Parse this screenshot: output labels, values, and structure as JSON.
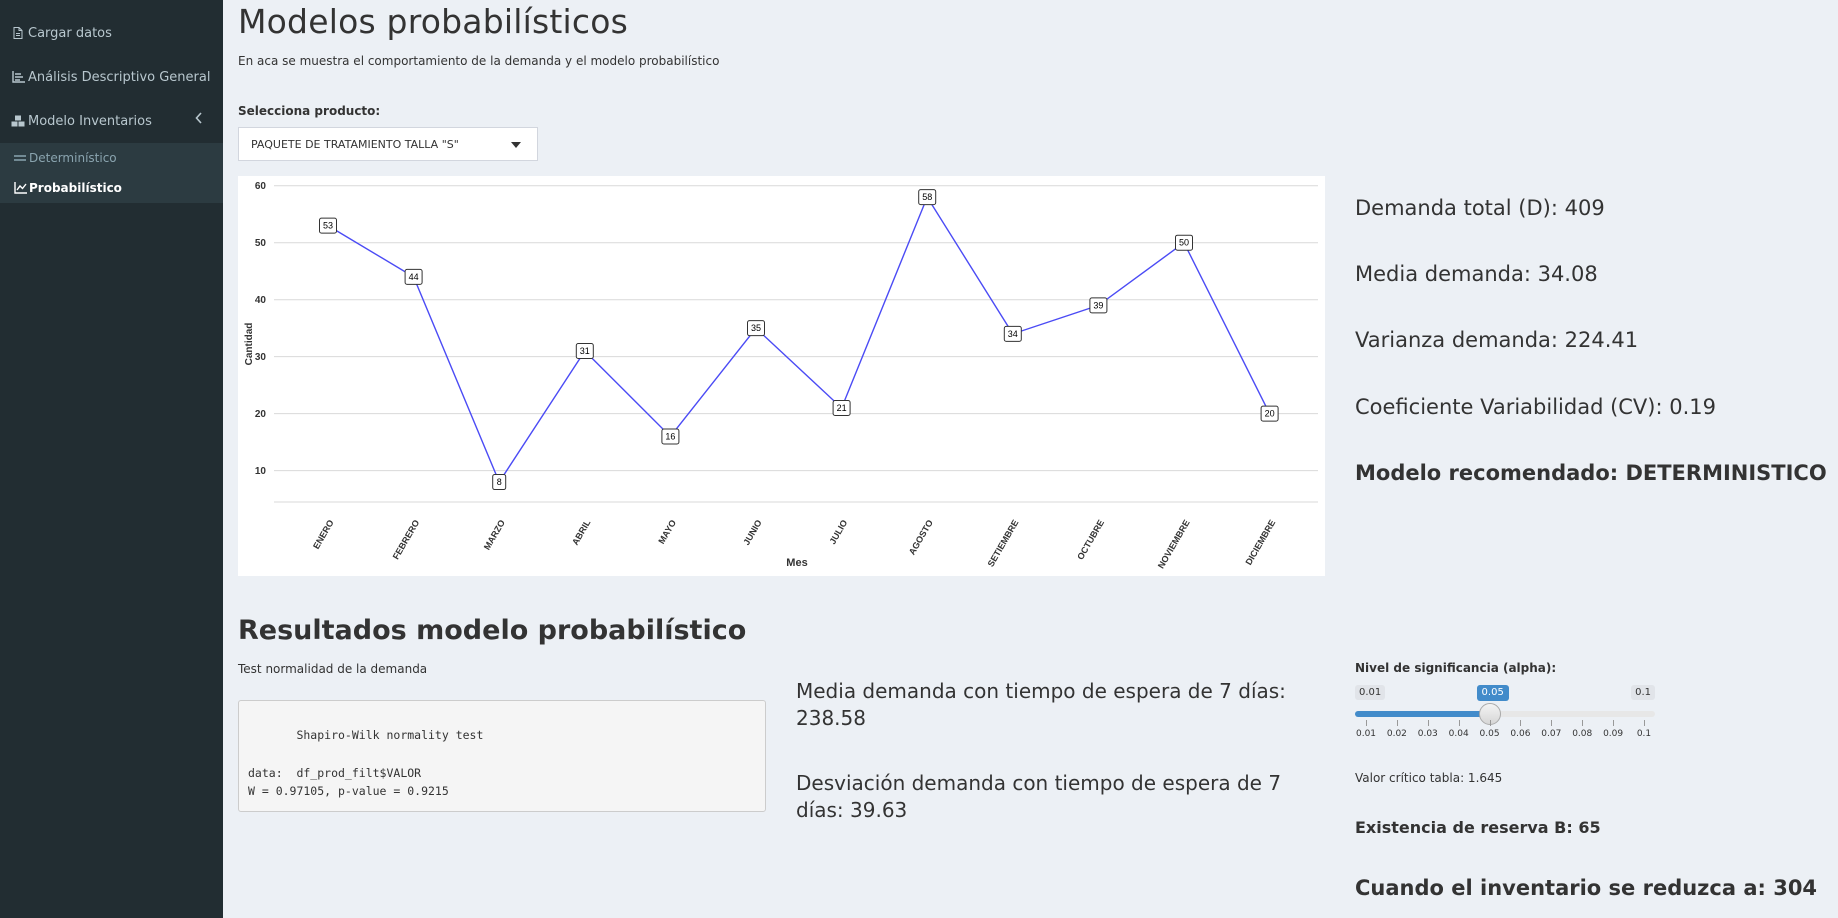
{
  "sidebar": {
    "items": [
      {
        "label": "Cargar datos",
        "icon": "file-icon"
      },
      {
        "label": "Análisis Descriptivo General",
        "icon": "chart-bar-icon"
      },
      {
        "label": "Modelo Inventarios",
        "icon": "cubes-icon"
      }
    ],
    "submenu": [
      {
        "label": "Determinístico",
        "icon": "bars-icon"
      },
      {
        "label": "Probabilístico",
        "icon": "line-chart-icon"
      }
    ]
  },
  "page": {
    "title": "Modelos probabilísticos",
    "subtitle": "En aca se muestra el comportamiento de la demanda y el modelo probabilístico"
  },
  "product_select": {
    "label": "Selecciona producto:",
    "value": "PAQUETE DE TRATAMIENTO TALLA \"S\""
  },
  "chart_data": {
    "type": "line",
    "categories": [
      "ENERO",
      "FEBRERO",
      "MARZO",
      "ABRIL",
      "MAYO",
      "JUNIO",
      "JULIO",
      "AGOSTO",
      "SETIEMBRE",
      "OCTUBRE",
      "NOVIEMBRE",
      "DICIEMBRE"
    ],
    "values": [
      53,
      44,
      8,
      31,
      16,
      35,
      21,
      58,
      34,
      39,
      50,
      20
    ],
    "xlabel": "Mes",
    "ylabel": "Cantidad",
    "yticks": [
      10,
      20,
      30,
      40,
      50,
      60
    ],
    "grid": true,
    "color": "#4b4bf5"
  },
  "stats": {
    "demanda_total": "Demanda total (D): 409",
    "media": "Media demanda: 34.08",
    "varianza": "Varianza demanda: 224.41",
    "cv": "Coeficiente Variabilidad (CV): 0.19",
    "modelo": "Modelo recomendado: DETERMINISTICO"
  },
  "results": {
    "title": "Resultados modelo probabilístico",
    "subtitle": "Test normalidad de la demanda",
    "test_output": [
      "       Shapiro-Wilk normality test",
      "data:  df_prod_filt$VALOR",
      "W = 0.97105, p-value = 0.9215"
    ],
    "media_espera": "Media demanda con tiempo de espera de 7 días: 238.58",
    "desviacion_espera": "Desviación demanda con tiempo de espera de 7 días: 39.63"
  },
  "slider": {
    "label": "Nivel de significancia (alpha):",
    "min_label": "0.01",
    "max_label": "0.1",
    "value_label": "0.05",
    "min": 0.01,
    "max": 0.1,
    "value": 0.05,
    "ticks": [
      "0.01",
      "0.02",
      "0.03",
      "0.04",
      "0.05",
      "0.06",
      "0.07",
      "0.08",
      "0.09",
      "0.1"
    ],
    "color": "#428bca"
  },
  "outputs": {
    "valor_critico": "Valor crítico tabla: 1.645",
    "reserva": "Existencia de reserva B: 65",
    "reduce": "Cuando el inventario se reduzca a: 304"
  }
}
